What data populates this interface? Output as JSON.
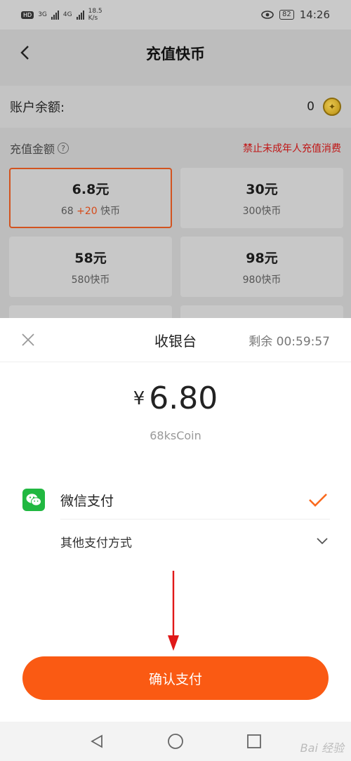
{
  "status_bar": {
    "hd_badge": "HD",
    "net_3g": "3G",
    "net_4g": "4G",
    "speed": "18.5",
    "speed_unit": "K/s",
    "battery": "82",
    "time": "14:26"
  },
  "header": {
    "title": "充值快币"
  },
  "balance": {
    "label": "账户余额:",
    "value": "0"
  },
  "recharge": {
    "label": "充值金额",
    "help": "?",
    "warning": "禁止未成年人充值消费",
    "options": [
      {
        "price": "6.8元",
        "coins_base": "68",
        "coins_bonus": "+20",
        "coins_unit": "快币",
        "selected": true
      },
      {
        "price": "30元",
        "coins": "300快币"
      },
      {
        "price": "58元",
        "coins": "580快币"
      },
      {
        "price": "98元",
        "coins": "980快币"
      }
    ]
  },
  "checkout": {
    "title": "收银台",
    "timer": "剩余 00:59:57",
    "currency_symbol": "¥",
    "amount": "6.80",
    "product": "68ksCoin",
    "methods": [
      {
        "name": "微信支付",
        "icon": "wechat-icon",
        "selected": true
      }
    ],
    "other_methods": "其他支付方式",
    "confirm_label": "确认支付"
  },
  "colors": {
    "accent": "#fa5a13",
    "selected_border": "#d2531f",
    "warning": "#c01515",
    "wechat": "#21b841"
  },
  "watermark": "Bai 经验"
}
